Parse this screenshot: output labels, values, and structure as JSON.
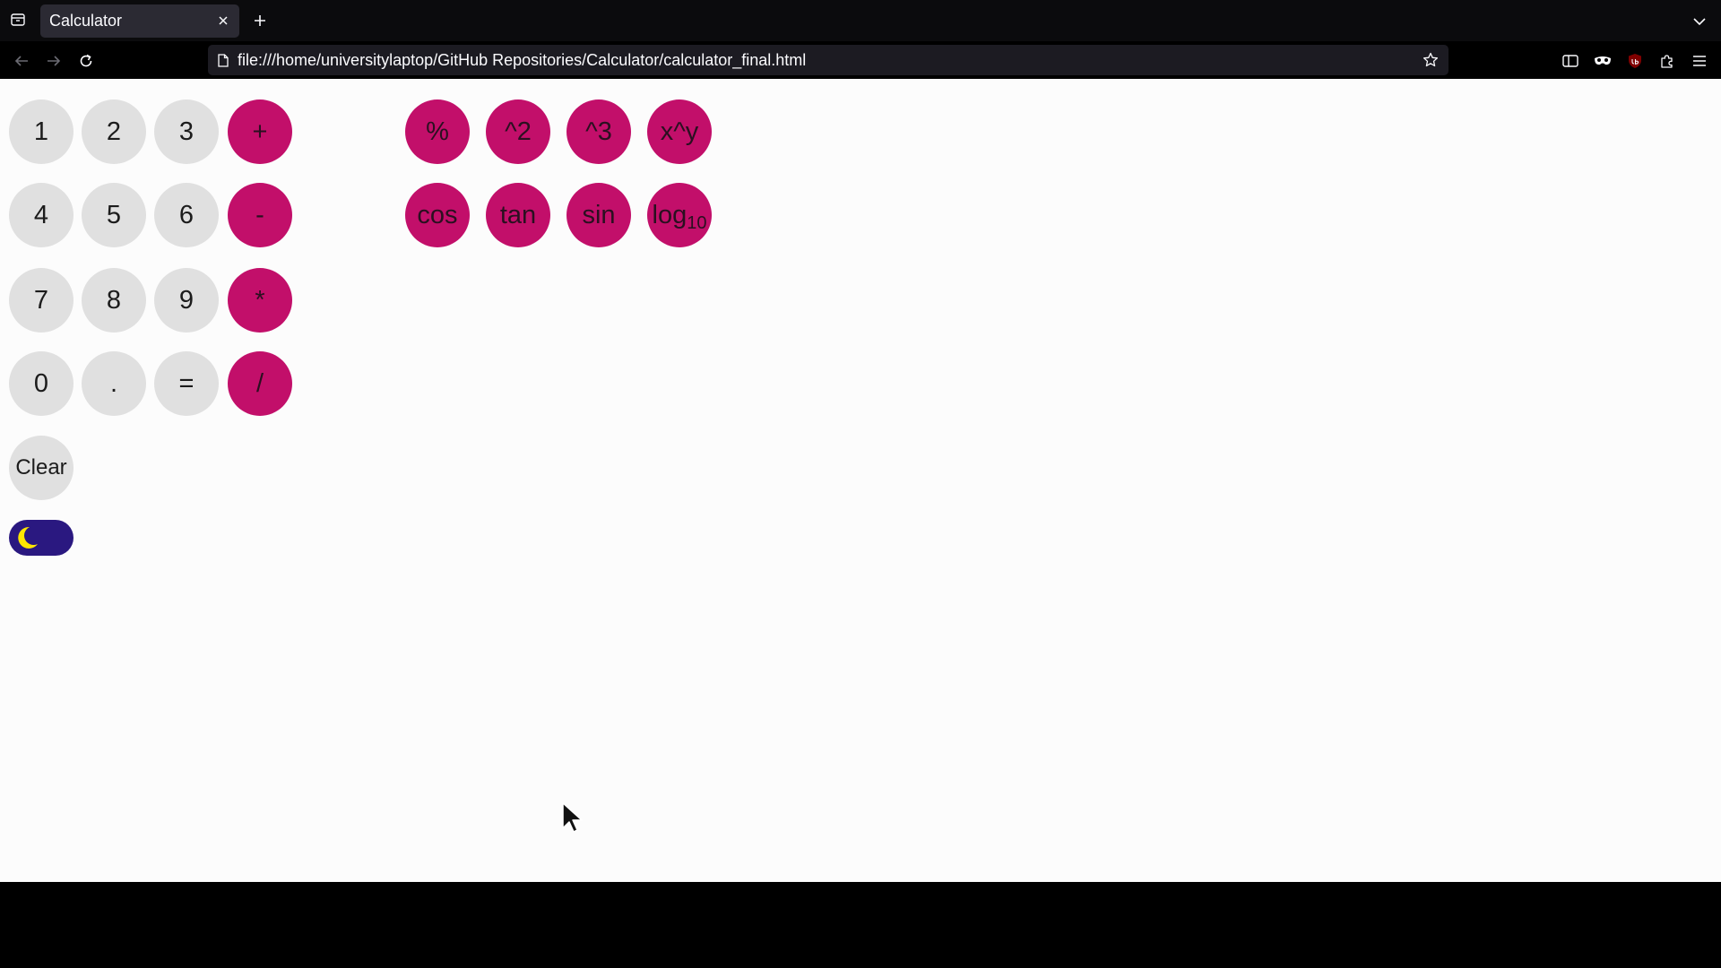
{
  "browser": {
    "tab_title": "Calculator",
    "url": "file:///home/universitylaptop/GitHub Repositories/Calculator/calculator_final.html"
  },
  "calculator": {
    "digits": [
      "1",
      "2",
      "3",
      "4",
      "5",
      "6",
      "7",
      "8",
      "9",
      "0",
      ".",
      "="
    ],
    "operators": [
      "+",
      "-",
      "*",
      "/"
    ],
    "functions": [
      "%",
      "^2",
      "^3",
      "x^y",
      "cos",
      "tan",
      "sin"
    ],
    "log_label": "log",
    "log_subscript": "10",
    "clear_label": "Clear",
    "theme_toggle_icon": "moon-icon"
  },
  "colors": {
    "operator_button": "#c20f6a",
    "number_button": "#e0e0e0",
    "toggle_background": "#2a1880",
    "moon": "#ffe600"
  }
}
